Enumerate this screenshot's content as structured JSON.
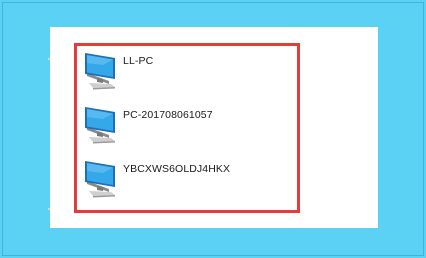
{
  "network": {
    "computers": [
      {
        "name": "LL-PC",
        "icon": "computer-icon"
      },
      {
        "name": "PC-201708061057",
        "icon": "computer-icon"
      },
      {
        "name": "YBCXWS6OLDJ4HKX",
        "icon": "computer-icon"
      }
    ]
  },
  "colors": {
    "background": "#5bd1f4",
    "highlight": "#e53b3b",
    "panel": "#ffffff"
  }
}
